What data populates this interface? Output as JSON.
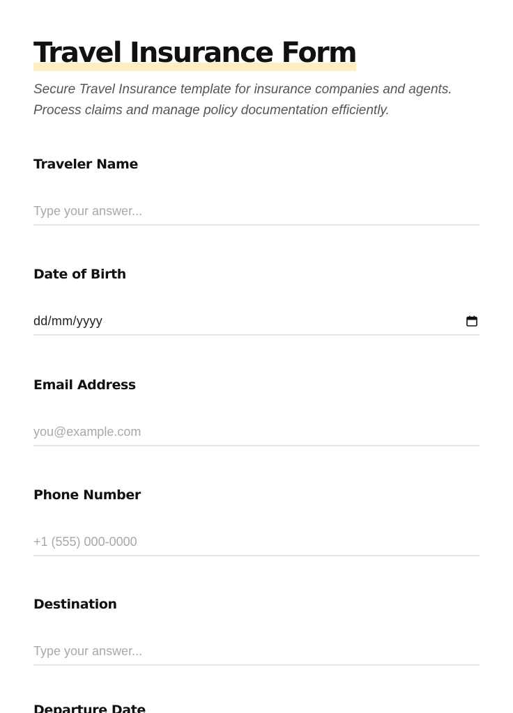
{
  "form": {
    "title": "Travel Insurance Form",
    "subtitle_line1": "Secure Travel Insurance template for insurance companies and agents.",
    "subtitle_line2": "Process claims and manage policy documentation efficiently.",
    "accent_color": "#fdefc2",
    "fields": [
      {
        "label": "Traveler Name",
        "placeholder": "Type your answer..."
      },
      {
        "label": "Date of Birth",
        "value": "dd/mm/yyyy",
        "icon": "calendar-icon"
      },
      {
        "label": "Email Address",
        "placeholder": "you@example.com"
      },
      {
        "label": "Phone Number",
        "placeholder": "+1 (555) 000-0000"
      },
      {
        "label": "Destination",
        "placeholder": "Type your answer..."
      },
      {
        "label": "Departure Date"
      }
    ]
  }
}
